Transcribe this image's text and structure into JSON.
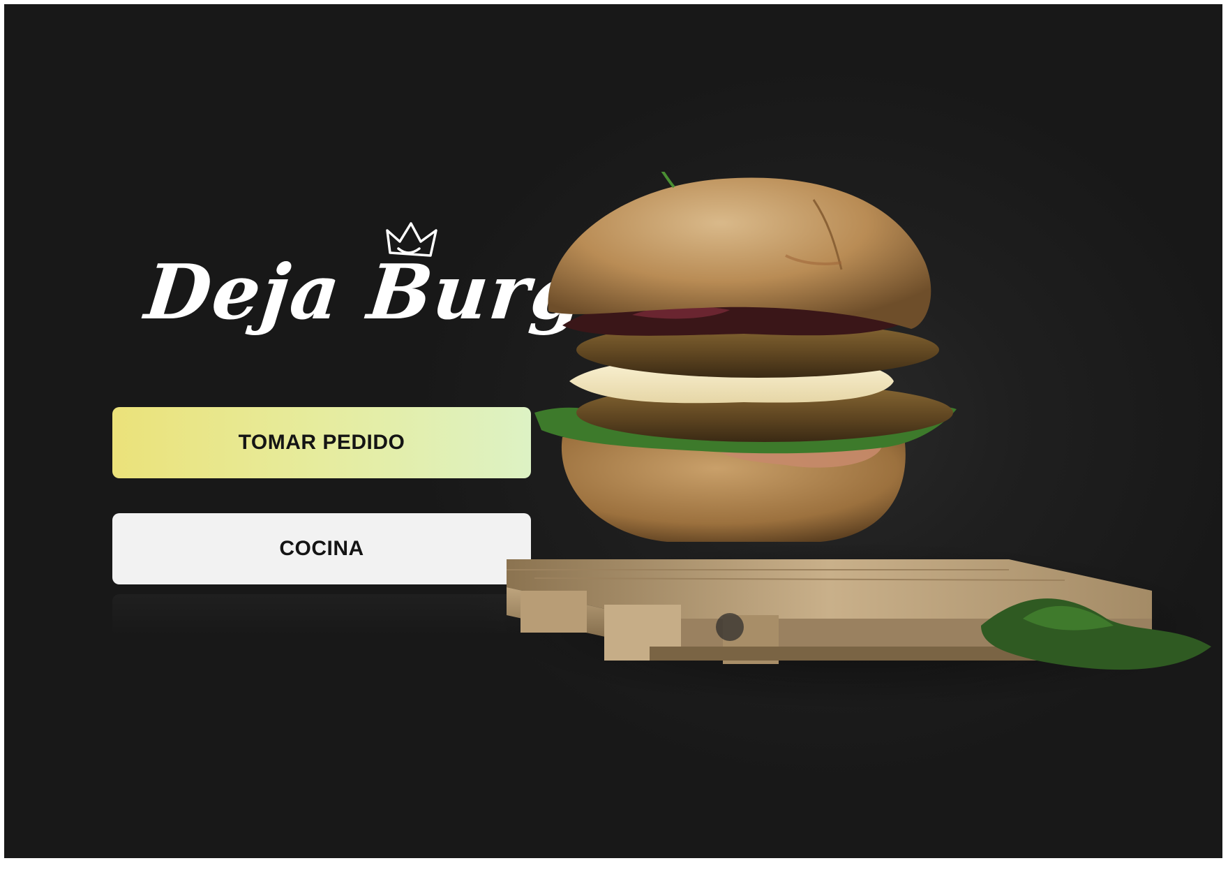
{
  "brand": {
    "name": "Deja Burg",
    "logo_icon": "crown-icon"
  },
  "actions": {
    "take_order_label": "TOMAR PEDIDO",
    "kitchen_label": "COCINA"
  },
  "colors": {
    "background": "#1f1f1f",
    "primary_gradient_start": "#ebe27a",
    "primary_gradient_end": "#ddf2c4",
    "secondary_button": "#f2f2f2",
    "button_text": "#141414"
  },
  "hero": {
    "subject": "burger-on-pallet-image"
  }
}
